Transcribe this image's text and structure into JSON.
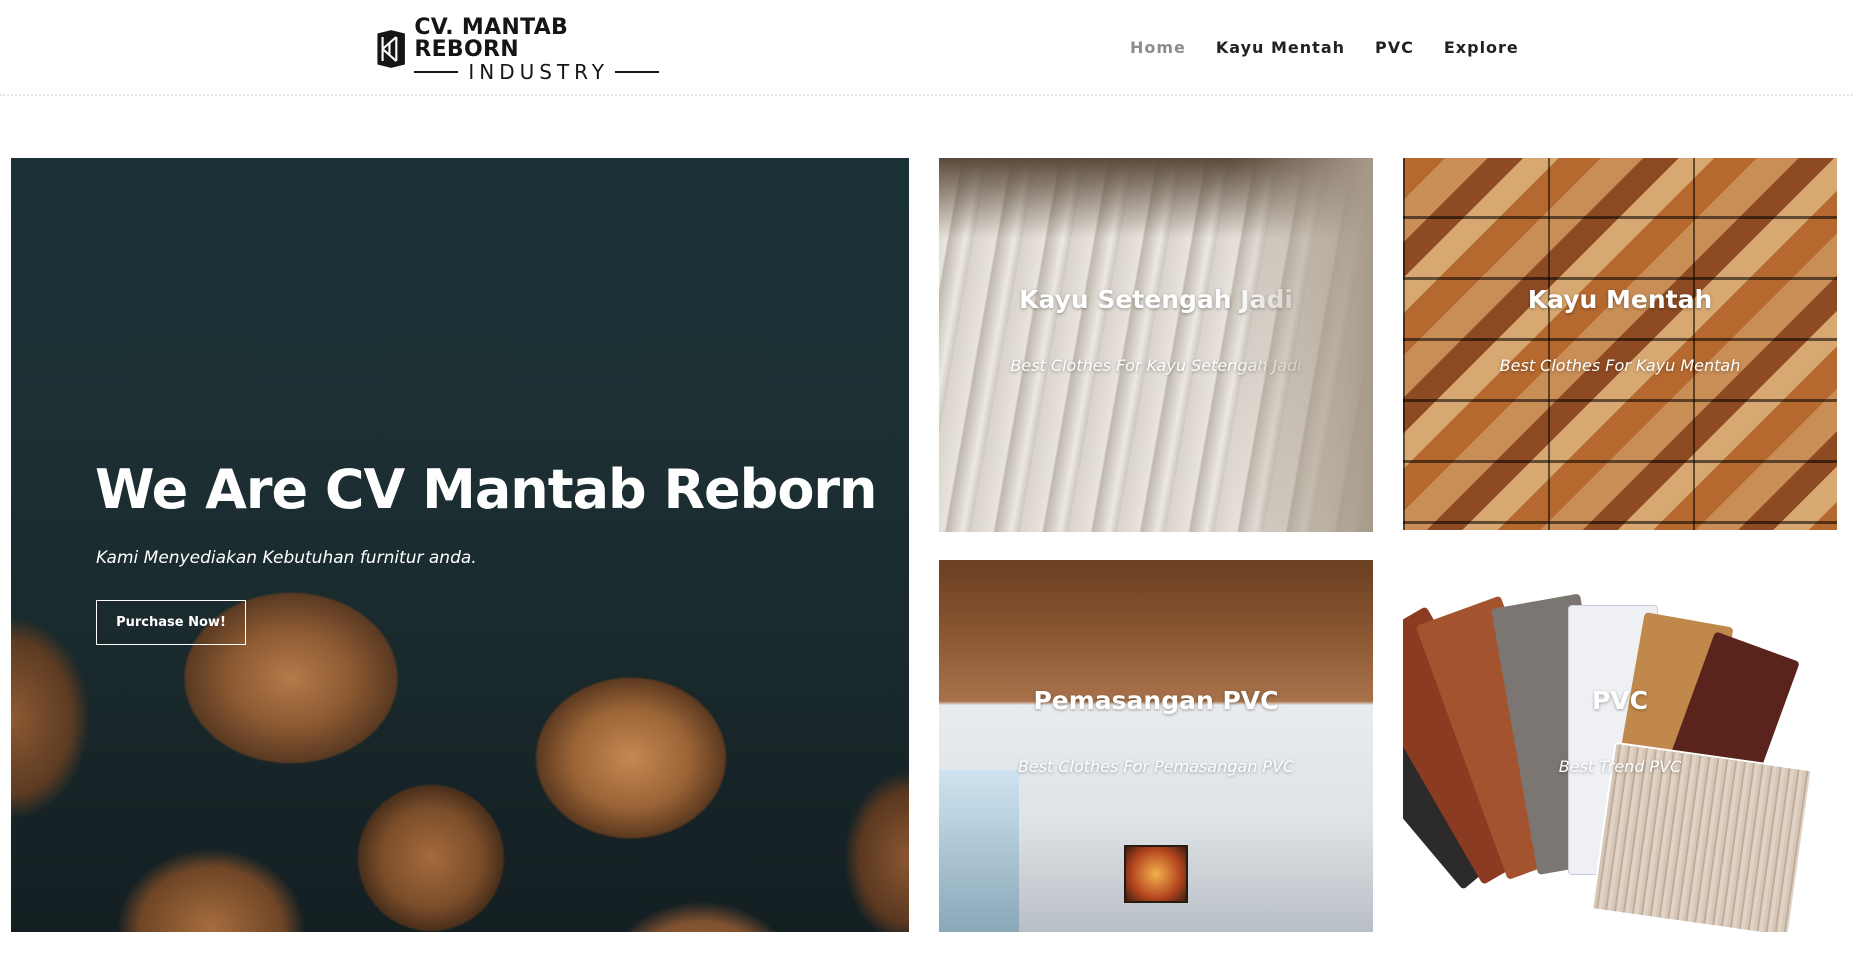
{
  "header": {
    "logo": {
      "line1": "CV. MANTAB REBORN",
      "line2": "INDUSTRY"
    },
    "nav": [
      {
        "label": "Home",
        "active": true
      },
      {
        "label": "Kayu Mentah",
        "active": false
      },
      {
        "label": "PVC",
        "active": false
      },
      {
        "label": "Explore",
        "active": false
      }
    ]
  },
  "hero": {
    "title": "We Are CV Mantab Reborn",
    "subtitle": "Kami Menyediakan Kebutuhan furnitur anda.",
    "button": "Purchase Now!"
  },
  "tiles": [
    {
      "title": "Kayu Setengah Jadi",
      "subtitle": "Best Clothes For Kayu Setengah Jadi"
    },
    {
      "title": "Kayu Mentah",
      "subtitle": "Best Clothes For Kayu Mentah"
    },
    {
      "title": "Pemasangan PVC",
      "subtitle": "Best Clothes For Pemasangan PVC"
    },
    {
      "title": "PVC",
      "subtitle": "Best Trend PVC"
    }
  ],
  "colors": {
    "text": "#1b1b1b",
    "nav_active": "#8d8d8d",
    "hero_bg": "#1a3136"
  }
}
